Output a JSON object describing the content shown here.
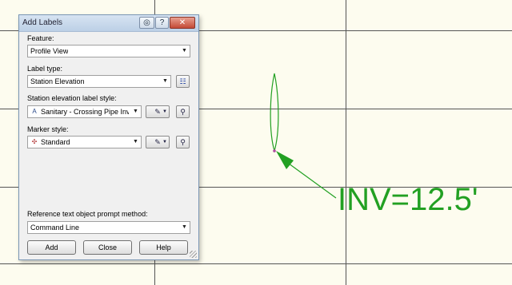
{
  "dialog": {
    "title": "Add Labels",
    "feature_label": "Feature:",
    "feature_value": "Profile View",
    "label_type_label": "Label type:",
    "label_type_value": "Station Elevation",
    "station_style_label": "Station elevation label style:",
    "station_style_value": "Sanitary - Crossing Pipe Inv",
    "marker_style_label": "Marker style:",
    "marker_style_value": "Standard",
    "ref_prompt_label": "Reference text object prompt method:",
    "ref_prompt_value": "Command Line",
    "add_button": "Add",
    "close_button": "Close",
    "help_button": "Help"
  },
  "drawing": {
    "annotation_text": "INV=12.5'",
    "annotation_color": "#22a022",
    "background_color": "#fdfcef",
    "grid_color": "#505050"
  }
}
